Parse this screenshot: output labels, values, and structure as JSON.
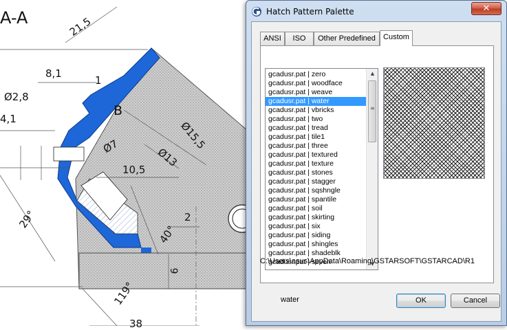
{
  "drawing": {
    "section_label": "A-A",
    "detail_label": "B",
    "dimensions": [
      "21,5",
      "8,1",
      "1",
      "Ø2,8",
      "4,1",
      "Ø7",
      "Ø15,5",
      "Ø13",
      "10,5",
      "29°",
      "2",
      "40°",
      "6",
      "119°",
      "38"
    ],
    "colors": {
      "hatch": "#1e67d8",
      "fill_gray": "#c8c8c8"
    }
  },
  "dialog": {
    "title": "Hatch Pattern Palette",
    "close_label": "✕",
    "tabs": [
      {
        "label": "ANSI"
      },
      {
        "label": "ISO"
      },
      {
        "label": "Other Predefined"
      },
      {
        "label": "Custom"
      }
    ],
    "active_tab": "Custom",
    "patterns": [
      "gcadusr.pat | zero",
      "gcadusr.pat | woodface",
      "gcadusr.pat | weave",
      "gcadusr.pat | water",
      "gcadusr.pat | vbricks",
      "gcadusr.pat | two",
      "gcadusr.pat | tread",
      "gcadusr.pat | tile1",
      "gcadusr.pat | three",
      "gcadusr.pat | textured",
      "gcadusr.pat | texture",
      "gcadusr.pat | stones",
      "gcadusr.pat | stagger",
      "gcadusr.pat | sqshngle",
      "gcadusr.pat | spantile",
      "gcadusr.pat | soil",
      "gcadusr.pat | skirting",
      "gcadusr.pat | six",
      "gcadusr.pat | siding",
      "gcadusr.pat | shingles",
      "gcadusr.pat | shadeblk",
      "gcadusr.pat | seven"
    ],
    "selected_index": 3,
    "path": "C:\\Users\\asus\\AppData\\Roaming\\GSTARSOFT\\GSTARCAD\\R1",
    "selected_name": "water",
    "ok_label": "OK",
    "cancel_label": "Cancel",
    "colors": {
      "selection": "#3399ff",
      "title_bg": "#c4d6ee",
      "close": "#c94b33"
    }
  }
}
